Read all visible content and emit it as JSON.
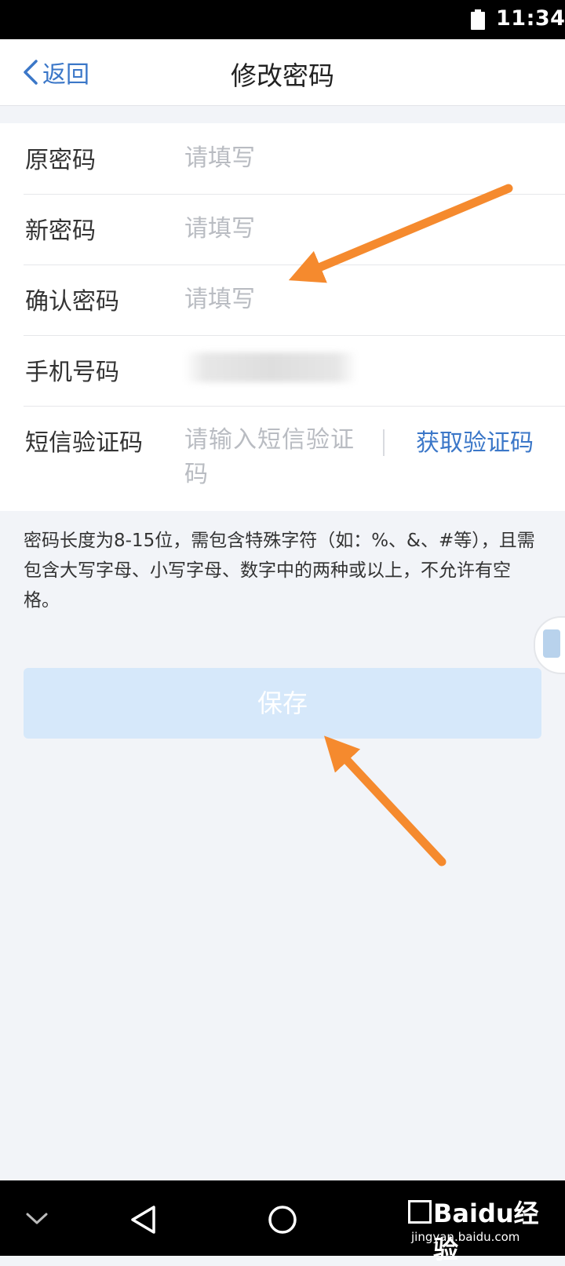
{
  "status_bar": {
    "time": "11:34"
  },
  "header": {
    "back_label": "返回",
    "title": "修改密码"
  },
  "form": {
    "rows": [
      {
        "label": "原密码",
        "placeholder": "请填写"
      },
      {
        "label": "新密码",
        "placeholder": "请填写"
      },
      {
        "label": "确认密码",
        "placeholder": "请填写"
      },
      {
        "label": "手机号码"
      },
      {
        "label": "短信验证码",
        "placeholder": "请输入短信验证码",
        "action": "获取验证码"
      }
    ]
  },
  "hint": "密码长度为8-15位，需包含特殊字符（如：%、&、#等），且需包含大写字母、小写字母、数字中的两种或以上，不允许有空格。",
  "save_button": {
    "label": "保存"
  },
  "colors": {
    "accent": "#3b77c8",
    "button_disabled": "#d6e8fa",
    "annotation_arrow": "#f58a2e"
  },
  "watermark": {
    "logo": "Baidu经验",
    "url": "jingyan.baidu.com"
  }
}
